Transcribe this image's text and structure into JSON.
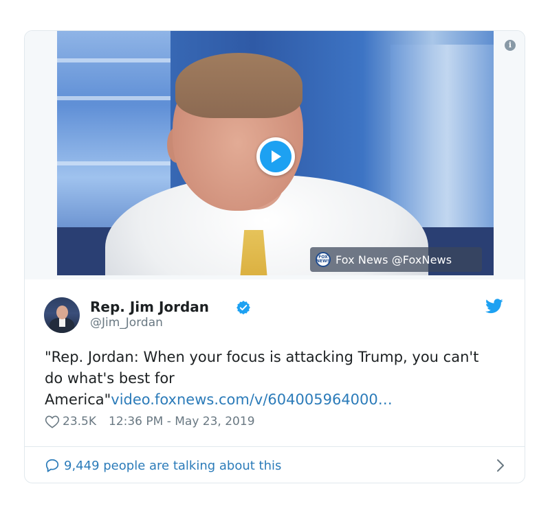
{
  "media": {
    "attribution": "Fox News @FoxNews",
    "logo_text": "FOX NEWS",
    "info_icon": "info-icon",
    "play_icon": "play-icon"
  },
  "tweet": {
    "display_name": "Rep. Jim Jordan",
    "handle": "@Jim_Jordan",
    "text": "\"Rep. Jordan: When your focus is attacking Trump, you can't do what's best for America\"",
    "link": "video.foxnews.com/v/604005964000…",
    "likes": "23.5K",
    "timestamp": "12:36 PM - May 23, 2019",
    "talking": "9,449 people are talking about this"
  },
  "colors": {
    "link": "#2b7bb9",
    "twitter_blue": "#1da1f2",
    "meta_gray": "#697882",
    "border": "#e1e8ed"
  }
}
